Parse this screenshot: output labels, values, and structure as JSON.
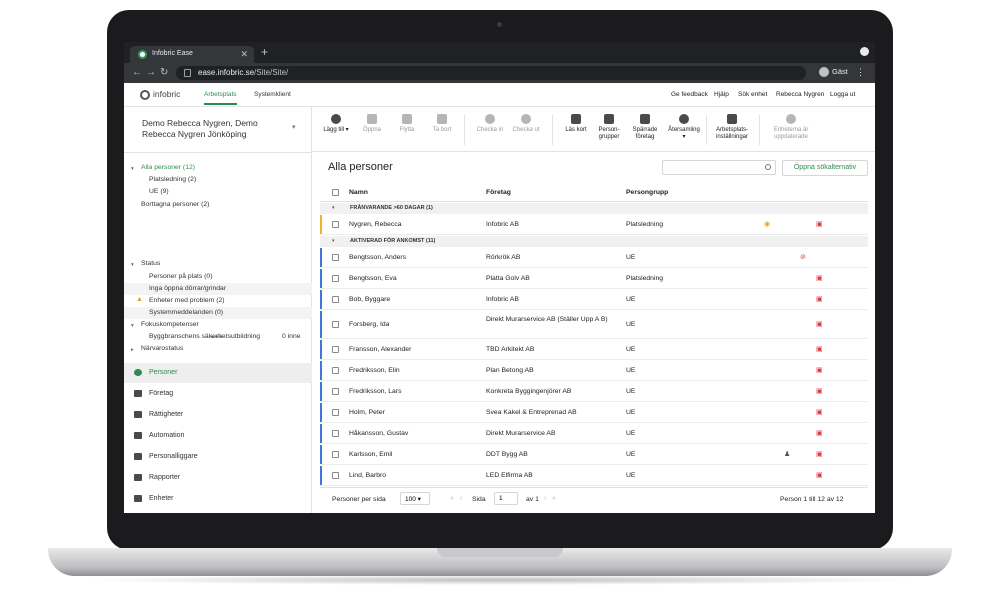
{
  "browser": {
    "tab_title": "Infobric Ease",
    "url_host": "ease.infobric.se",
    "url_path": "/Site/Site/",
    "profile_label": "Gäst"
  },
  "header": {
    "brand": "infobric",
    "tabs": [
      "Arbetsplats",
      "Systemklient"
    ],
    "links": [
      "Ge feedback",
      "Hjälp",
      "Sök enhet",
      "Rebecca Nygren",
      "Logga ut"
    ]
  },
  "sidebar": {
    "site_title": "Demo Rebecca Nygren, Demo Rebecca Nygren Jönköping",
    "tree": {
      "all": "Alla personer (12)",
      "children": [
        "Platsledning (2)",
        "UE (9)"
      ],
      "removed": "Borttagna personer (2)"
    },
    "status": {
      "title": "Status",
      "items": [
        "Personer på plats (0)",
        "Inga öppna dörrar/grindar",
        "Enheter med problem (2)",
        "Systemmeddelanden (0)"
      ]
    },
    "focus": {
      "title": "Fokuskompetenser",
      "item": "Byggbranschens säkerhetsutbildning",
      "count": "0 inne"
    },
    "presence": "Närvarostatus",
    "more": "•••",
    "nav": [
      "Personer",
      "Företag",
      "Rättigheter",
      "Automation",
      "Personalliggare",
      "Rapporter",
      "Enheter"
    ]
  },
  "toolbar": {
    "add": "Lägg till",
    "open": "Öppna",
    "move": "Flytta",
    "delete": "Ta bort",
    "checkin": "Checka in",
    "checkout": "Checka ut",
    "readcard": "Läs kort",
    "groups_1": "Person-",
    "groups_2": "grupper",
    "blocked_1": "Spärrade",
    "blocked_2": "företag",
    "gather": "Återsamling",
    "site_settings_1": "Arbetsplats-",
    "site_settings_2": "inställningar",
    "units_1": "Enheterna är",
    "units_2": "uppdaterade"
  },
  "main": {
    "title": "Alla personer",
    "advanced_search": "Öppna sökalternativ",
    "columns": [
      "Namn",
      "Företag",
      "Persongrupp"
    ],
    "group_absent": "FRÅNVARANDE >60 DAGAR (1)",
    "group_active": "AKTIVERAD FÖR ANKOMST (11)",
    "absent_rows": [
      {
        "name": "Nygren, Rebecca",
        "company": "Infobric AB",
        "group": "Platsledning"
      }
    ],
    "rows": [
      {
        "name": "Bengtsson, Anders",
        "company": "Rörkrök AB",
        "group": "UE"
      },
      {
        "name": "Bengtsson, Eva",
        "company": "Platta Golv AB",
        "group": "Platsledning"
      },
      {
        "name": "Bob, Byggare",
        "company": "Infobric AB",
        "group": "UE"
      },
      {
        "name": "Forsberg, Ida",
        "company": "Direkt Murarservice AB (Ställer Upp A B)",
        "group": "UE"
      },
      {
        "name": "Fransson, Alexander",
        "company": "TBD Arkitekt AB",
        "group": "UE"
      },
      {
        "name": "Fredriksson, Elin",
        "company": "Plan Betong AB",
        "group": "UE"
      },
      {
        "name": "Fredriksson, Lars",
        "company": "Konkreta Byggingenjörer AB",
        "group": "UE"
      },
      {
        "name": "Holm, Peter",
        "company": "Svea Kakel & Entreprenad AB",
        "group": "UE"
      },
      {
        "name": "Håkansson, Gustav",
        "company": "Direkt Murarservice AB",
        "group": "UE"
      },
      {
        "name": "Karlsson, Emil",
        "company": "DDT Bygg AB",
        "group": "UE"
      },
      {
        "name": "Lind, Barbro",
        "company": "LED Elfirma AB",
        "group": "UE"
      }
    ],
    "footer": {
      "per_page_label": "Personer per sida",
      "per_page_value": "100",
      "page_label": "Sida",
      "page_value": "1",
      "page_of": "av 1",
      "range": "Person 1 till 12 av 12"
    }
  }
}
